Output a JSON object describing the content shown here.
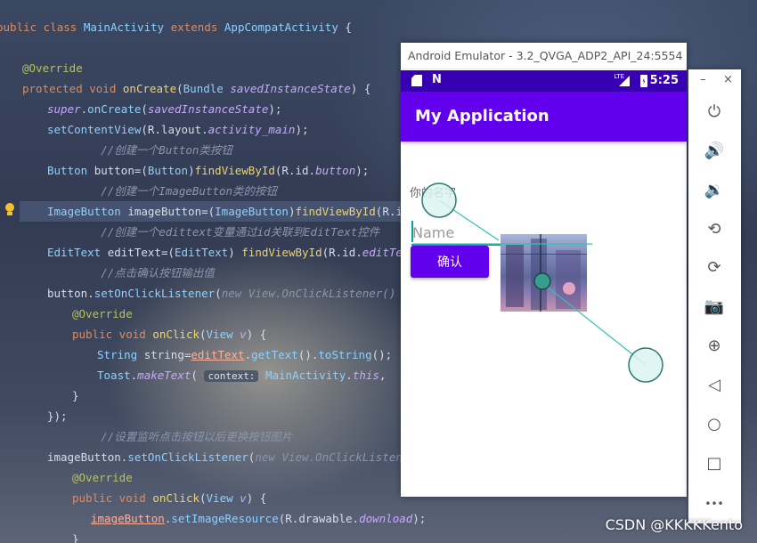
{
  "code": {
    "lines": [
      "public class MainActivity extends AppCompatActivity {",
      "",
      "    @Override",
      "    protected void onCreate(Bundle savedInstanceState) {",
      "        super.onCreate(savedInstanceState);",
      "        setContentView(R.layout.activity_main);",
      "        //创建一个Button类按钮",
      "        Button button=(Button)findViewById(R.id.button);",
      "        //创建一个ImageButton类的按钮",
      "        ImageButton imageButton=(ImageButton)findViewById(R.id.im",
      "        //创建一个edittext变量通过id关联到EditText控件",
      "        EditText editText=(EditText) findViewById(R.id.editTextTe",
      "        //点击确认按钮输出值",
      "        button.setOnClickListener(new View.OnClickListener() {",
      "            @Override",
      "            public void onClick(View v) {",
      "                String string=editText.getText().toString();",
      "                Toast.makeText( context: MainActivity.this,  text: \"",
      "            }",
      "        });",
      "        //设置监听点击按钮以后更换按钮图片",
      "        imageButton.setOnClickListener(new View.OnClickListener()",
      "            @Override",
      "            public void onClick(View v) {",
      "                imageButton.setImageResource(R.drawable.download);",
      "            }"
    ]
  },
  "emulator": {
    "title": "Android Emulator - 3.2_QVGA_ADP2_API_24:5554",
    "status": {
      "time": "5:25",
      "network": "LTE"
    },
    "app_title": "My Application",
    "label": "你的名字",
    "edit_placeholder": "Name",
    "confirm_label": "确认",
    "controls": {
      "minimize": "–",
      "close": "×"
    },
    "tools": [
      "power-icon",
      "volume-up-icon",
      "volume-down-icon",
      "rotate-left-icon",
      "rotate-right-icon",
      "camera-icon",
      "zoom-icon",
      "back-icon",
      "home-icon",
      "overview-icon",
      "more-icon"
    ],
    "more_label": "•••"
  },
  "watermark": "CSDN @KKKKKento",
  "colors": {
    "primary": "#6200ee",
    "status_bar": "#3800b3",
    "accent": "#02a59a"
  }
}
